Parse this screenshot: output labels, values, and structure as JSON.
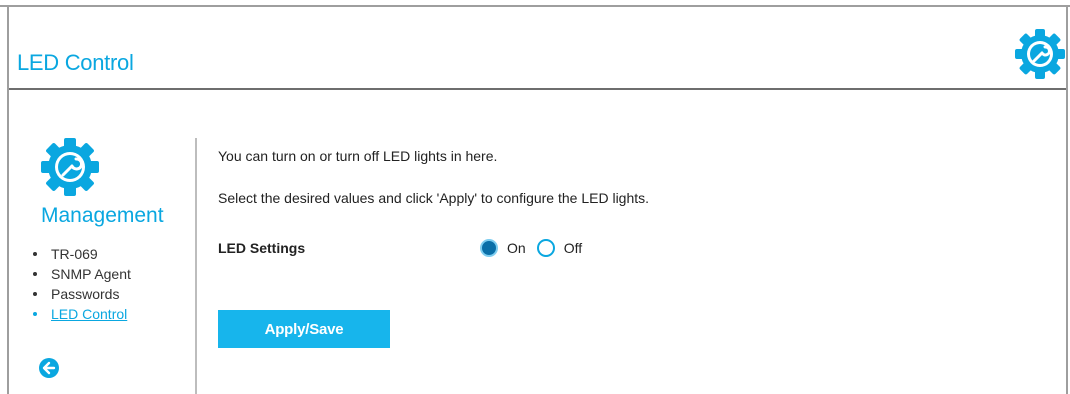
{
  "header": {
    "title": "LED Control",
    "icon": "settings-gear-icon"
  },
  "sidebar": {
    "title": "Management",
    "icon": "settings-gear-icon",
    "items": [
      {
        "label": "TR-069",
        "active": false
      },
      {
        "label": "SNMP Agent",
        "active": false
      },
      {
        "label": "Passwords",
        "active": false
      },
      {
        "label": "LED Control",
        "active": true
      }
    ],
    "back_icon": "back-arrow-icon"
  },
  "main": {
    "description_1": "You can turn on or turn off LED lights in here.",
    "description_2": "Select the desired values and click 'Apply' to configure the LED lights.",
    "led_settings_label": "LED Settings",
    "options": [
      {
        "label": "On",
        "selected": true
      },
      {
        "label": "Off",
        "selected": false
      }
    ],
    "apply_label": "Apply/Save"
  },
  "colors": {
    "accent": "#0aa7e0",
    "button": "#17b5ec",
    "radio_selected": "#0a6fa8"
  }
}
